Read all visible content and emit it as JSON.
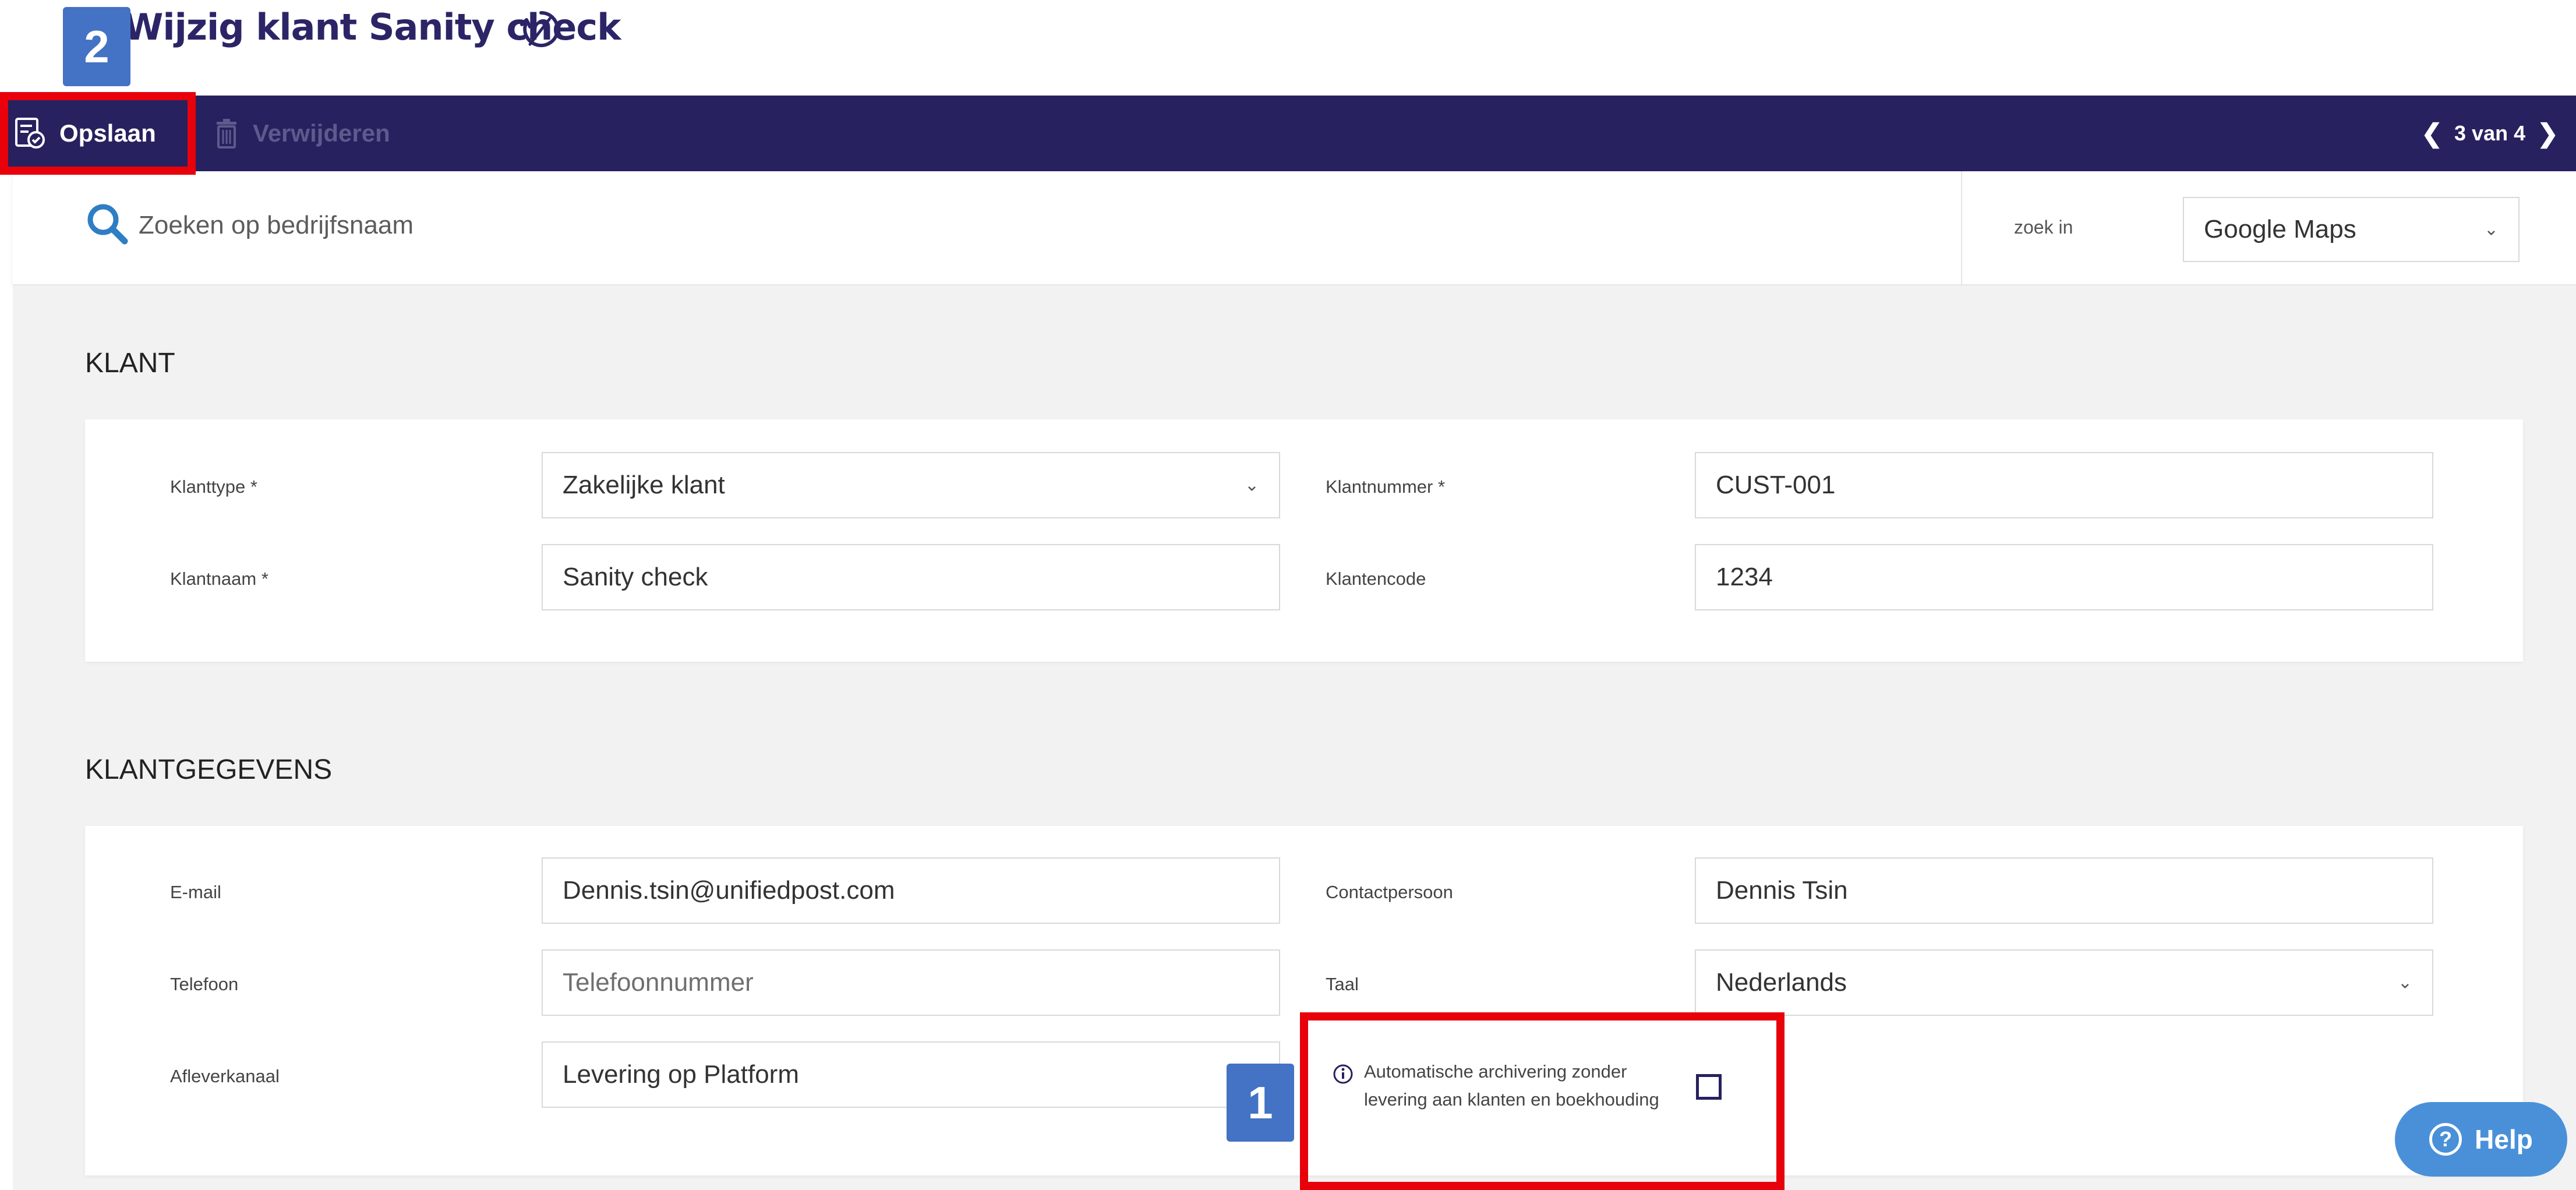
{
  "header": {
    "title": "Wijzig klant Sanity check",
    "title_icon": "refresh-circle-icon"
  },
  "toolbar": {
    "save_label": "Opslaan",
    "save_icon": "save-document-icon",
    "delete_label": "Verwijderen",
    "delete_icon": "trash-icon",
    "pager": "3 van 4"
  },
  "search": {
    "placeholder": "Zoeken op bedrijfsnaam",
    "zoek_in_label": "zoek in",
    "zoek_in_value": "Google Maps"
  },
  "klant": {
    "section_title": "KLANT",
    "klanttype_label": "Klanttype *",
    "klanttype_value": "Zakelijke klant",
    "klantnummer_label": "Klantnummer *",
    "klantnummer_value": "CUST-001",
    "klantnaam_label": "Klantnaam *",
    "klantnaam_value": "Sanity check",
    "klantencode_label": "Klantencode",
    "klantencode_value": "1234"
  },
  "klantgegevens": {
    "section_title": "KLANTGEGEVENS",
    "email_label": "E-mail",
    "email_value": "Dennis.tsin@unifiedpost.com",
    "contact_label": "Contactpersoon",
    "contact_value": "Dennis Tsin",
    "telefoon_label": "Telefoon",
    "telefoon_placeholder": "Telefoonnummer",
    "taal_label": "Taal",
    "taal_value": "Nederlands",
    "afleverkanaal_label": "Afleverkanaal",
    "afleverkanaal_value": "Levering op Platform",
    "archivering_line1": "Automatische archivering zonder",
    "archivering_line2": "levering aan klanten en boekhouding",
    "archivering_checked": false
  },
  "annotations": {
    "badge_1": "1",
    "badge_2": "2"
  },
  "help": {
    "label": "Help"
  },
  "colors": {
    "brand": "#27215f",
    "highlight": "#e8000b",
    "badge": "#4472c4",
    "help": "#4a90d9"
  }
}
